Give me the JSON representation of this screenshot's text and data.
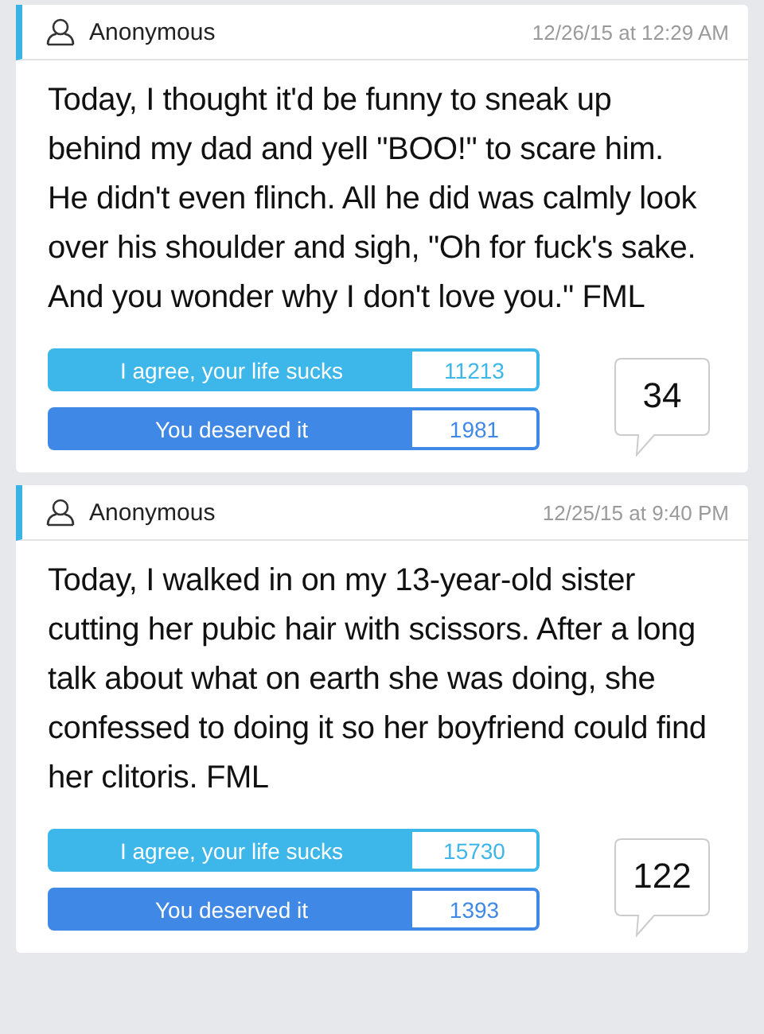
{
  "posts": [
    {
      "author": "Anonymous",
      "date": "12/26/15 at 12:29 AM",
      "text": "Today, I thought it'd be funny to sneak up behind my dad and yell \"BOO!\" to scare him. He didn't even flinch. All he did was calmly look over his shoulder and sigh, \"Oh for fuck's sake. And you wonder why I don't love you.\" FML",
      "votes": [
        {
          "kind": "agree",
          "label": "I agree, your life sucks",
          "count": "11213"
        },
        {
          "kind": "deserved",
          "label": "You deserved it",
          "count": "1981"
        }
      ],
      "comments": "34"
    },
    {
      "author": "Anonymous",
      "date": "12/25/15 at 9:40 PM",
      "text": "Today, I walked in on my 13-year-old sister cutting her pubic hair with scissors. After a long talk about what on earth she was doing, she confessed to doing it so her boyfriend could find her clitoris. FML",
      "votes": [
        {
          "kind": "agree",
          "label": "I agree, your life sucks",
          "count": "15730"
        },
        {
          "kind": "deserved",
          "label": "You deserved it",
          "count": "1393"
        }
      ],
      "comments": "122"
    }
  ]
}
